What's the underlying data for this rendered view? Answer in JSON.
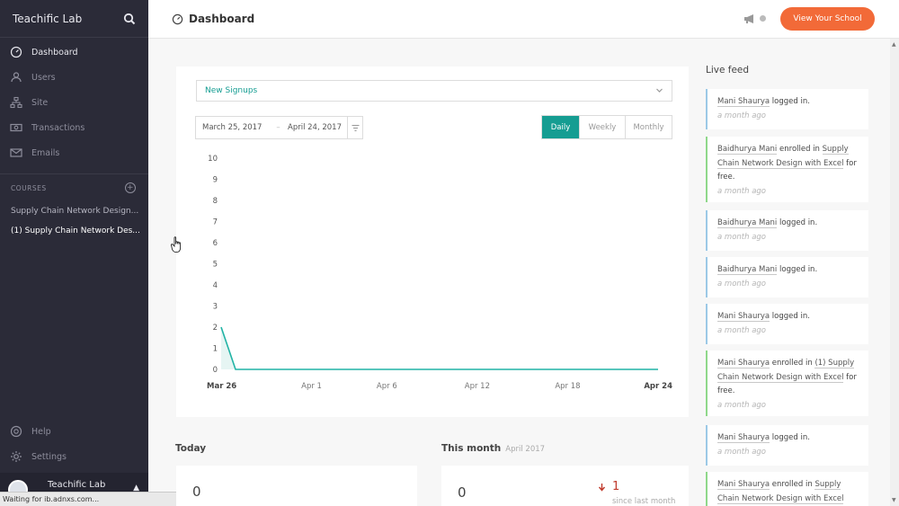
{
  "sidebar": {
    "title": "Teachific Lab",
    "nav": [
      {
        "label": "Dashboard",
        "icon": "gauge-icon"
      },
      {
        "label": "Users",
        "icon": "users-icon"
      },
      {
        "label": "Site",
        "icon": "sitemap-icon"
      },
      {
        "label": "Transactions",
        "icon": "money-icon"
      },
      {
        "label": "Emails",
        "icon": "envelope-icon"
      }
    ],
    "courses_heading": "COURSES",
    "courses": [
      "Supply Chain Network Design...",
      "(1) Supply Chain Network Des..."
    ],
    "bottom": [
      {
        "label": "Help",
        "icon": "help-icon"
      },
      {
        "label": "Settings",
        "icon": "gear-icon"
      }
    ],
    "footer_name": "Teachific Lab"
  },
  "status_bar": "Waiting for ib.adnxs.com...",
  "topbar": {
    "title": "Dashboard",
    "cta": "View Your School"
  },
  "panel": {
    "metric": "New Signups",
    "date_from": "March 25, 2017",
    "date_sep": "–",
    "date_to": "April 24, 2017",
    "ranges": [
      "Daily",
      "Weekly",
      "Monthly"
    ],
    "active_range": "Daily"
  },
  "chart_data": {
    "type": "line",
    "x_ticks": [
      "Mar 26",
      "Apr 1",
      "Apr 6",
      "Apr 12",
      "Apr 18",
      "Apr 24"
    ],
    "y_ticks": [
      0,
      1,
      2,
      3,
      4,
      5,
      6,
      7,
      8,
      9,
      10
    ],
    "ylim": [
      0,
      10
    ],
    "x_range": [
      "2017-03-26",
      "2017-04-24"
    ],
    "series": [
      {
        "values": [
          2,
          0,
          0,
          0,
          0,
          0,
          0,
          0,
          0,
          0,
          0,
          0,
          0,
          0,
          0,
          0,
          0,
          0,
          0,
          0,
          0,
          0,
          0,
          0,
          0,
          0,
          0,
          0,
          0,
          0
        ]
      }
    ],
    "color": "#21b3a5"
  },
  "stats": {
    "today_title": "Today",
    "today_value": "0",
    "month_title": "This month",
    "month_sub": "April 2017",
    "month_value": "0",
    "month_delta": "1",
    "month_since": "since last month"
  },
  "live_feed": {
    "title": "Live feed",
    "items": [
      {
        "name": "Mani Shaurya",
        "text": " logged in.",
        "time": "a month ago",
        "kind": "login"
      },
      {
        "name": "Baidhurya Mani",
        "text": " enrolled in ",
        "course": "Supply Chain Network Design with Excel",
        "suffix": " for free.",
        "time": "a month ago",
        "kind": "enroll"
      },
      {
        "name": "Baidhurya Mani",
        "text": " logged in.",
        "time": "a month ago",
        "kind": "login"
      },
      {
        "name": "Baidhurya Mani",
        "text": " logged in.",
        "time": "a month ago",
        "kind": "login"
      },
      {
        "name": "Mani Shaurya",
        "text": " logged in.",
        "time": "a month ago",
        "kind": "login"
      },
      {
        "name": "Mani Shaurya",
        "text": " enrolled in ",
        "course": "(1) Supply Chain Network Design with Excel",
        "suffix": " for free.",
        "time": "a month ago",
        "kind": "enroll"
      },
      {
        "name": "Mani Shaurya",
        "text": " logged in.",
        "time": "a month ago",
        "kind": "login"
      },
      {
        "name": "Mani Shaurya",
        "text": " enrolled in ",
        "course": "Supply Chain Network Design with Excel",
        "suffix": "",
        "time": "",
        "kind": "enroll"
      }
    ]
  },
  "colors": {
    "accent": "#f26a38",
    "teal": "#159d92",
    "sidebar": "#2b2b38"
  }
}
